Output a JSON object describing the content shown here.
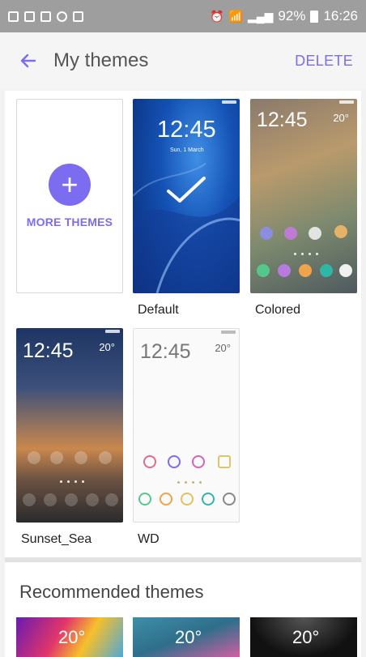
{
  "status_bar": {
    "battery": "92%",
    "time": "16:26"
  },
  "app_bar": {
    "title": "My themes",
    "delete_label": "DELETE"
  },
  "my_themes": {
    "more_label": "MORE THEMES",
    "items": [
      {
        "name": "Default",
        "clock": "12:45",
        "date": "Sun, 1 March",
        "applied": true
      },
      {
        "name": "Colored",
        "clock": "12:45",
        "weather": "20°"
      },
      {
        "name": "Sunset_Sea",
        "clock": "12:45",
        "weather": "20°"
      },
      {
        "name": "WD",
        "clock": "12:45",
        "weather": "20°"
      }
    ]
  },
  "recommended": {
    "title": "Recommended themes",
    "thumbs": [
      {
        "weather": "20°"
      },
      {
        "weather": "20°"
      },
      {
        "weather": "20°"
      }
    ]
  },
  "colors": {
    "accent": "#7b6cf0",
    "status_bar": "#9e9e9e"
  }
}
